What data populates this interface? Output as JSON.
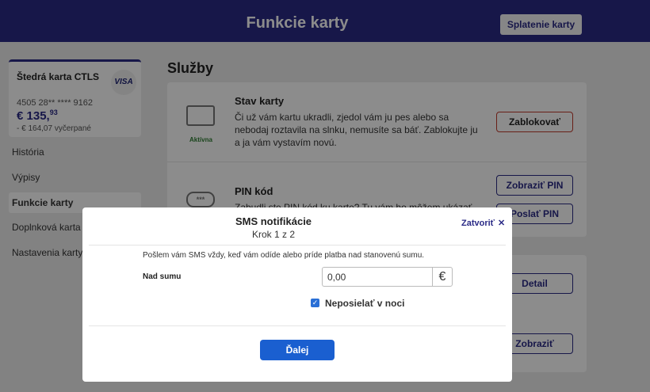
{
  "topbar": {
    "title": "Funkcie karty",
    "pay_button": "Splatenie karty"
  },
  "card": {
    "name": "Štedrá karta CTLS",
    "brand": "VISA",
    "number": "4505 28** **** 9162",
    "balance_main": "€ 135,",
    "balance_cents": "93",
    "used": "- € 164,07 vyčerpané"
  },
  "sidebar": {
    "items": [
      {
        "label": "História"
      },
      {
        "label": "Výpisy"
      },
      {
        "label": "Funkcie karty"
      },
      {
        "label": "Doplnková karta"
      },
      {
        "label": "Nastavenia karty"
      }
    ],
    "active_index": 2
  },
  "section": {
    "title": "Služby"
  },
  "rows": {
    "status": {
      "title": "Stav karty",
      "text": "Či už vám kartu ukradli, zjedol vám ju pes alebo sa nebodaj roztavila na slnku, nemusíte sa báť. Zablokujte ju a ja vám vystavím novú.",
      "badge": "Aktívna",
      "button": "Zablokovať"
    },
    "pin": {
      "title": "PIN kód",
      "icon_text": "***",
      "text_partial": "Zabudli ste PIN kód ku karte? Tu vám ho môžem ukázať",
      "show_button": "Zobraziť PIN",
      "send_button": "Poslať PIN"
    },
    "detail_button": "Detail",
    "show_button": "Zobraziť"
  },
  "modal": {
    "title": "SMS notifikácie",
    "step": "Krok 1 z 2",
    "close_label": "Zatvoriť",
    "description": "Pošlem vám SMS vždy, keď vám odíde alebo príde platba nad stanovenú sumu.",
    "amount_label": "Nad sumu",
    "amount_value": "0,00",
    "currency": "€",
    "night_checkbox_label": "Neposielať v noci",
    "night_checkbox_checked": true,
    "next_button": "Ďalej"
  },
  "colors": {
    "brand": "#2a2a86",
    "primary_button": "#1a5fd0",
    "danger": "#c0392b",
    "active": "#2e7d32"
  }
}
